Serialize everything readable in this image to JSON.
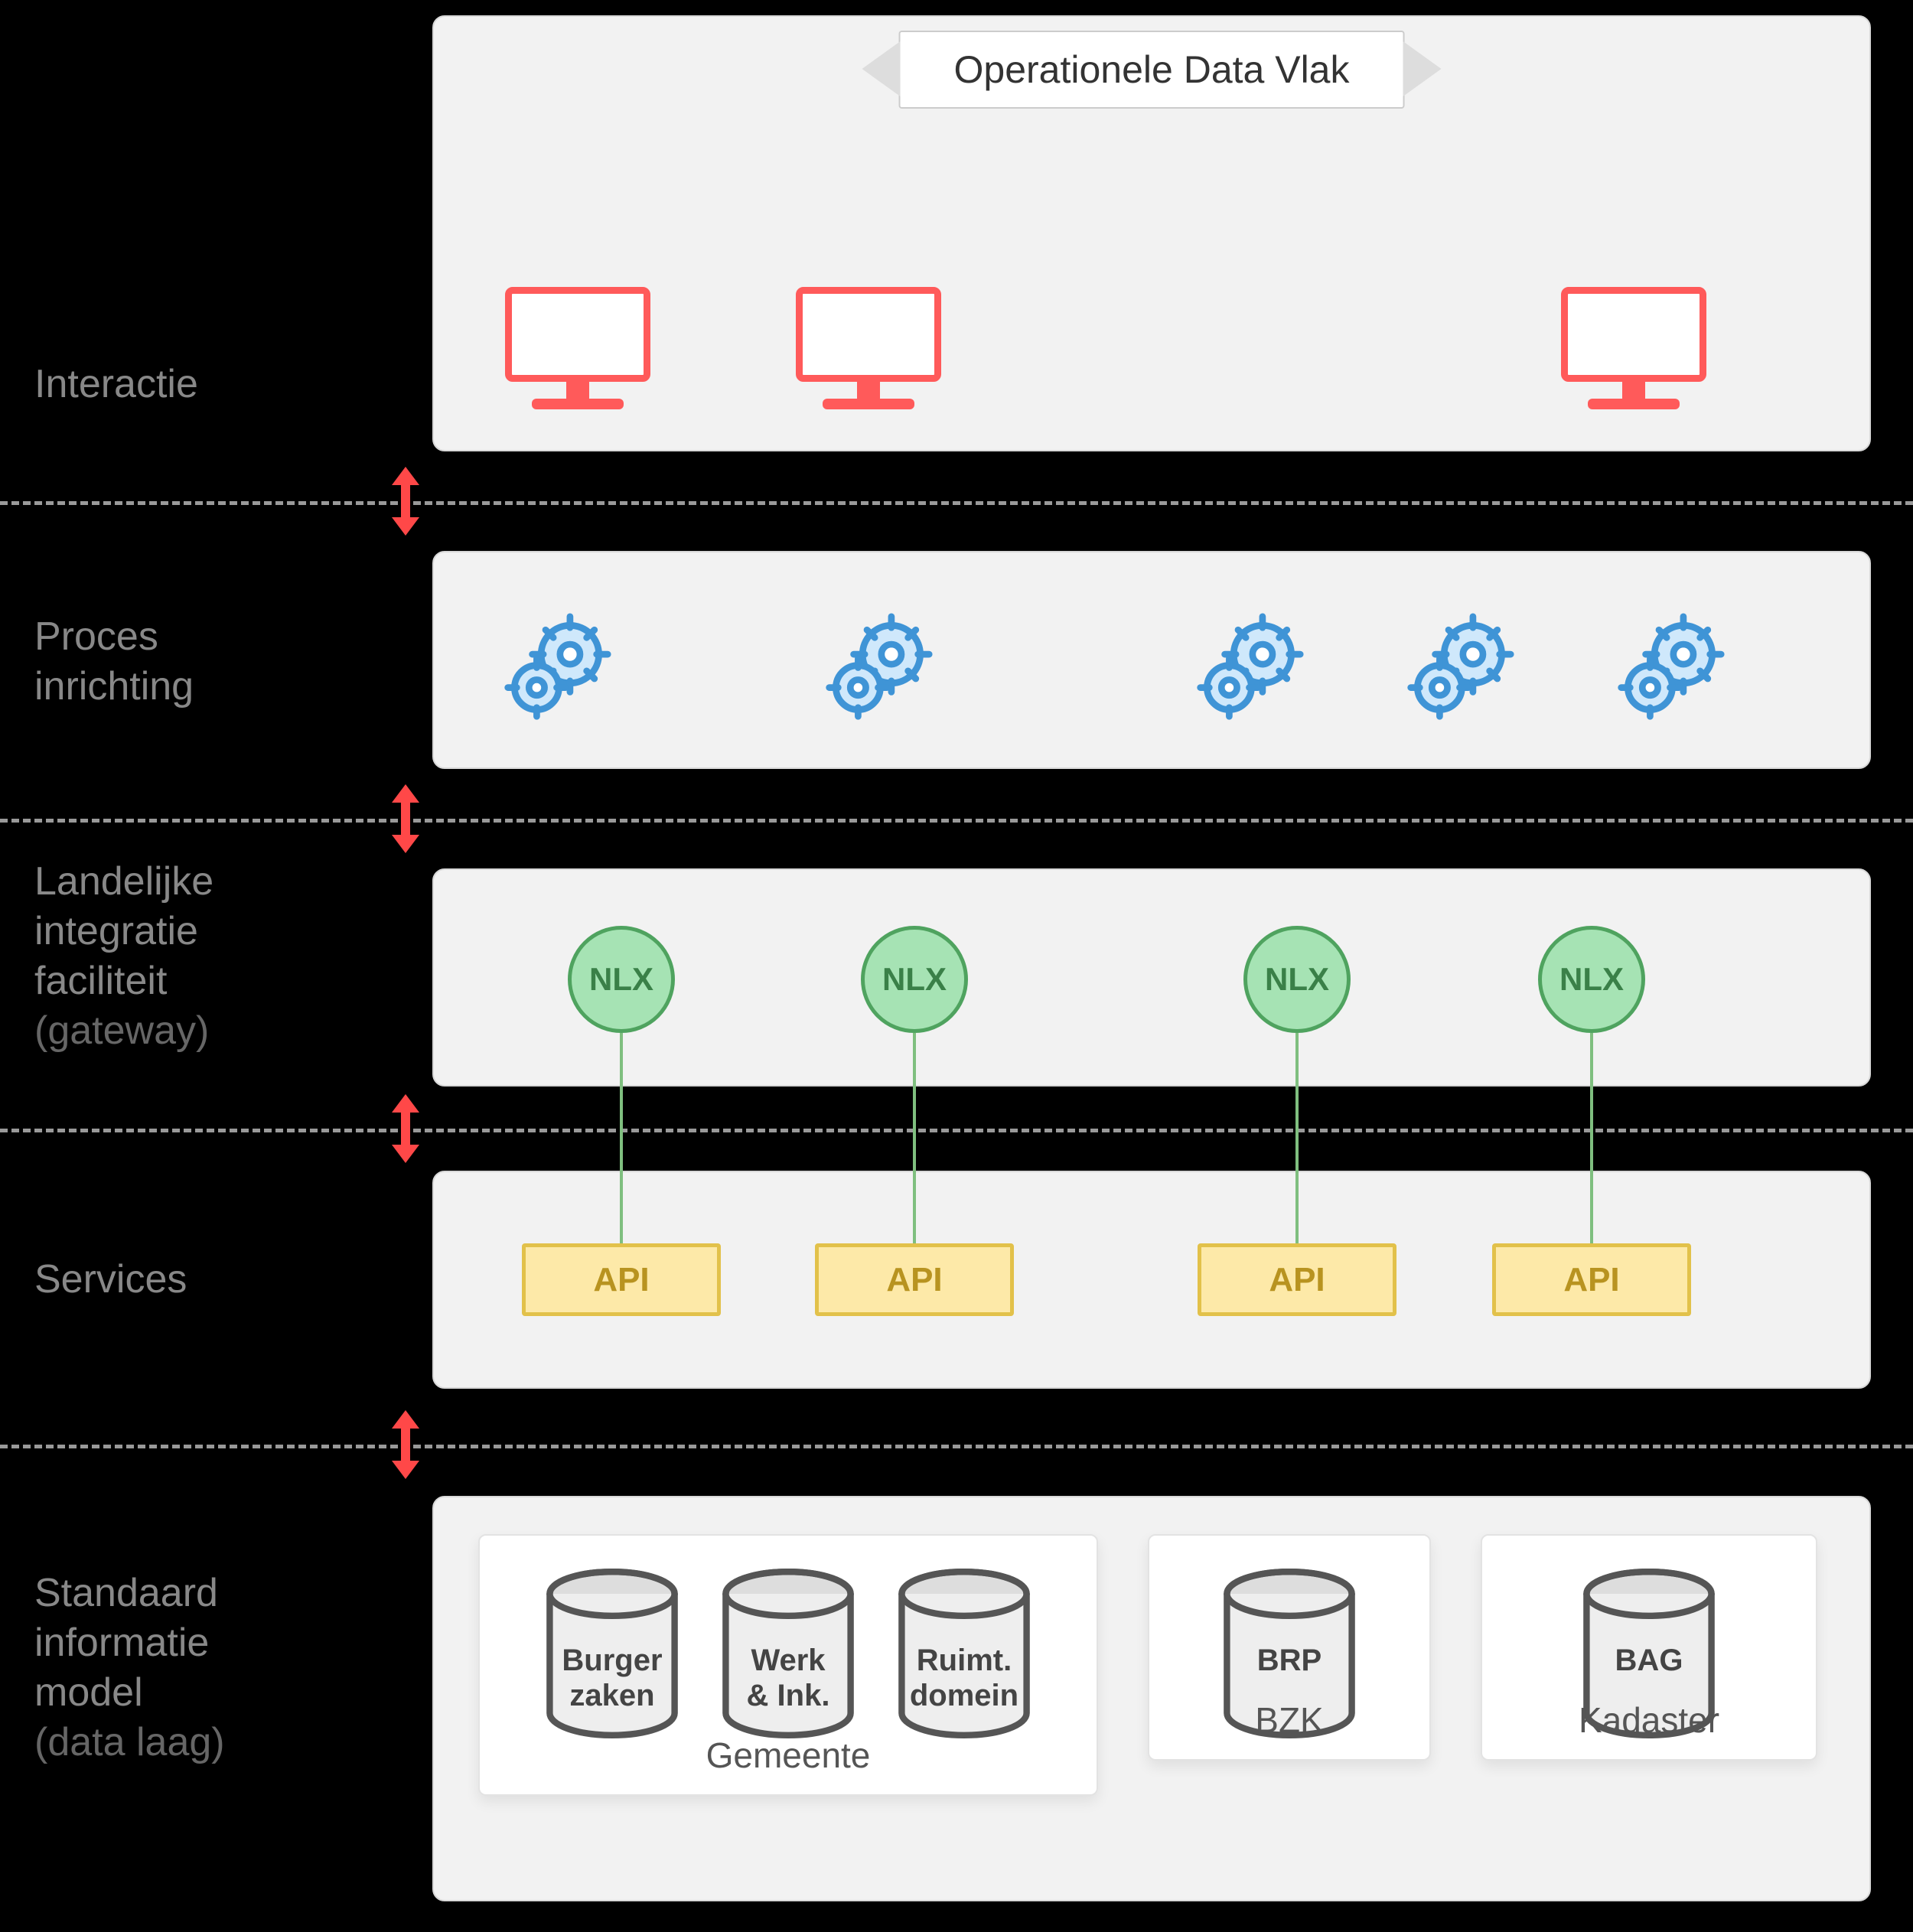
{
  "banner": {
    "title": "Operationele Data Vlak"
  },
  "layers": {
    "interactie": {
      "label": "Interactie"
    },
    "proces": {
      "label": "Proces\ninrichting"
    },
    "gateway": {
      "label": "Landelijke\nintegratie\nfaciliteit",
      "sub": "(gateway)"
    },
    "services": {
      "label": "Services"
    },
    "data": {
      "label": "Standaard\ninformatie\nmodel",
      "sub": "(data laag)"
    }
  },
  "nlx_label": "NLX",
  "api_label": "API",
  "datasources": {
    "gemeente": {
      "title": "Gemeente",
      "dbs": [
        "Burger\nzaken",
        "Werk\n& Ink.",
        "Ruimt.\ndomein"
      ]
    },
    "bzk": {
      "title": "BZK",
      "dbs": [
        "BRP"
      ]
    },
    "kadaster": {
      "title": "Kadaster",
      "dbs": [
        "BAG"
      ]
    }
  }
}
